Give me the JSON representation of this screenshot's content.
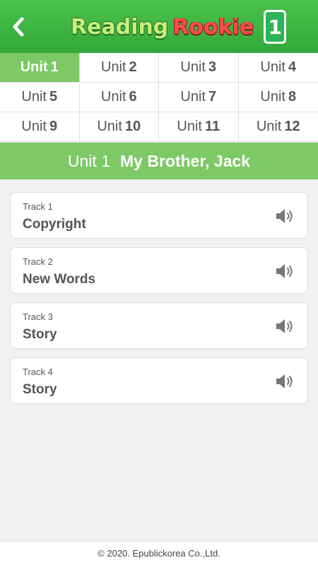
{
  "header": {
    "back_icon": "chevron-left-icon",
    "logo_part1": "Reading",
    "logo_part2": "Rookie",
    "logo_number": "1"
  },
  "units": [
    {
      "prefix": "Unit",
      "num": "1",
      "active": true
    },
    {
      "prefix": "Unit",
      "num": "2"
    },
    {
      "prefix": "Unit",
      "num": "3"
    },
    {
      "prefix": "Unit",
      "num": "4"
    },
    {
      "prefix": "Unit",
      "num": "5"
    },
    {
      "prefix": "Unit",
      "num": "6"
    },
    {
      "prefix": "Unit",
      "num": "7"
    },
    {
      "prefix": "Unit",
      "num": "8"
    },
    {
      "prefix": "Unit",
      "num": "9"
    },
    {
      "prefix": "Unit",
      "num": "10"
    },
    {
      "prefix": "Unit",
      "num": "11"
    },
    {
      "prefix": "Unit",
      "num": "12"
    }
  ],
  "title": {
    "unit": "Unit 1",
    "name": "My Brother, Jack"
  },
  "tracks": [
    {
      "label": "Track 1",
      "title": "Copyright",
      "icon": "speaker-icon"
    },
    {
      "label": "Track 2",
      "title": "New Words",
      "icon": "speaker-icon"
    },
    {
      "label": "Track 3",
      "title": "Story",
      "icon": "speaker-icon"
    },
    {
      "label": "Track 4",
      "title": "Story",
      "icon": "speaker-icon"
    }
  ],
  "footer": {
    "copyright": "© 2020. Epublickorea Co.,Ltd."
  },
  "colors": {
    "header_green": "#33a83a",
    "accent_green": "#7cc966",
    "background": "#f1f1f1"
  }
}
